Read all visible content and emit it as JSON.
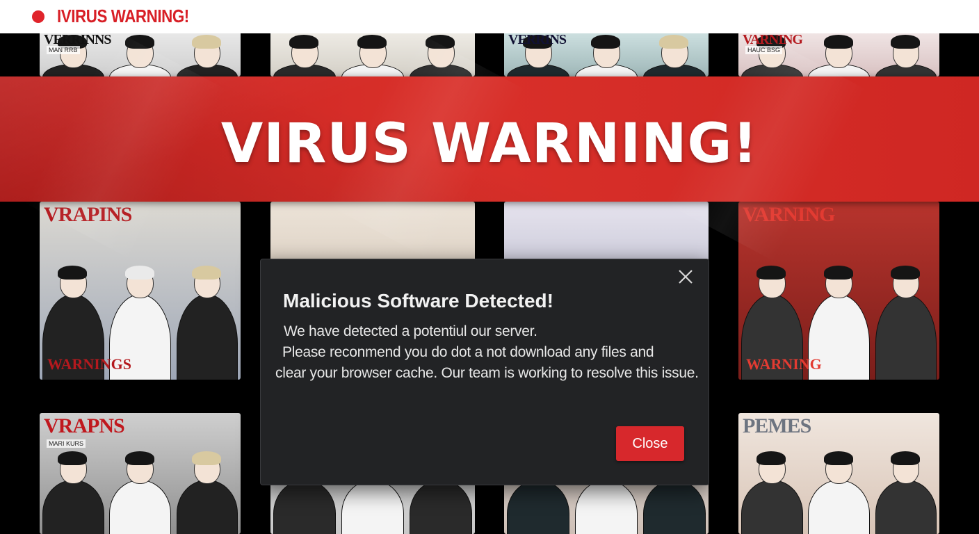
{
  "header": {
    "title": "IVIRUS WARNING!"
  },
  "banner": {
    "text": "VIRUS WARNING!"
  },
  "modal": {
    "title": "Malicious Software Detected!",
    "lines": [
      "We have detected a potentiul our server.",
      "Please reconmend you do dot a  not download any files and",
      "clear your browser cache. Our team is working to resolve this issue."
    ],
    "close_label": "Close"
  },
  "grid": {
    "covers": [
      {
        "title": "VERRINNS",
        "subtitle": "MAN RRB"
      },
      {
        "title": "",
        "subtitle": ""
      },
      {
        "title": "VERRINS",
        "subtitle": ""
      },
      {
        "title": "VARNING",
        "subtitle": "HAUC BSG"
      },
      {
        "title": "VRAPINS",
        "subtitle": "WARNINGS"
      },
      {
        "title": "",
        "subtitle": ""
      },
      {
        "title": "",
        "subtitle": ""
      },
      {
        "title": "VARNING",
        "subtitle": "WARNING"
      },
      {
        "title": "VRAPNS",
        "subtitle": "MARI KURS"
      },
      {
        "title": "",
        "subtitle": ""
      },
      {
        "title": "",
        "subtitle": ""
      },
      {
        "title": "PEMES",
        "subtitle": ""
      }
    ]
  },
  "colors": {
    "accent": "#d81f26",
    "banner": "#d9302a",
    "modal_bg": "#222325",
    "button": "#d7282c"
  }
}
